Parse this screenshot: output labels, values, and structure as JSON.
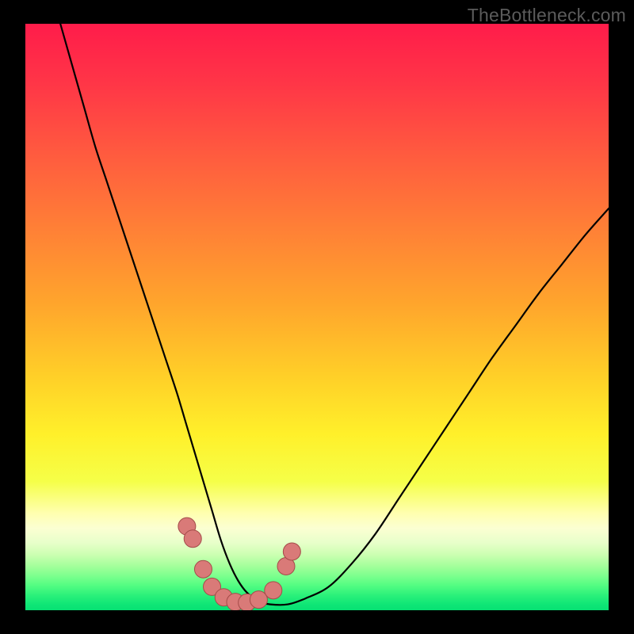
{
  "watermark": "TheBottleneck.com",
  "colors": {
    "frame": "#000000",
    "curve_stroke": "#000000",
    "marker_fill": "#d97a78",
    "marker_stroke": "#a44b49",
    "gradient_stops": [
      {
        "offset": 0.0,
        "color": "#ff1c4a"
      },
      {
        "offset": 0.1,
        "color": "#ff3547"
      },
      {
        "offset": 0.22,
        "color": "#ff5a3f"
      },
      {
        "offset": 0.35,
        "color": "#ff8036"
      },
      {
        "offset": 0.48,
        "color": "#ffa62c"
      },
      {
        "offset": 0.6,
        "color": "#ffcf28"
      },
      {
        "offset": 0.7,
        "color": "#fff02a"
      },
      {
        "offset": 0.78,
        "color": "#f5ff48"
      },
      {
        "offset": 0.835,
        "color": "#ffffb0"
      },
      {
        "offset": 0.86,
        "color": "#fbffd2"
      },
      {
        "offset": 0.885,
        "color": "#e8ffca"
      },
      {
        "offset": 0.905,
        "color": "#ccffb2"
      },
      {
        "offset": 0.925,
        "color": "#a3ff9b"
      },
      {
        "offset": 0.942,
        "color": "#7bff8d"
      },
      {
        "offset": 0.958,
        "color": "#52fd82"
      },
      {
        "offset": 0.975,
        "color": "#2af07a"
      },
      {
        "offset": 0.99,
        "color": "#0fe676"
      },
      {
        "offset": 1.0,
        "color": "#07e173"
      }
    ]
  },
  "chart_data": {
    "type": "line",
    "title": "",
    "xlabel": "",
    "ylabel": "",
    "xlim": [
      0,
      100
    ],
    "ylim": [
      0,
      100
    ],
    "series": [
      {
        "name": "bottleneck-curve",
        "x": [
          6,
          8,
          10,
          12,
          14,
          16,
          18,
          20,
          22,
          24,
          26,
          27.5,
          29,
          30.5,
          32,
          33.5,
          35,
          36.5,
          38,
          40,
          42,
          45,
          48,
          52,
          56,
          60,
          64,
          68,
          72,
          76,
          80,
          84,
          88,
          92,
          96,
          100
        ],
        "y": [
          100,
          93,
          86,
          79,
          73,
          67,
          61,
          55,
          49,
          43,
          37,
          32,
          27,
          22,
          17,
          12,
          8,
          5,
          3,
          1.5,
          1,
          1,
          2,
          4,
          8,
          13,
          19,
          25,
          31,
          37,
          43,
          48.5,
          54,
          59,
          64,
          68.5
        ]
      }
    ],
    "markers": {
      "name": "highlighted-points",
      "x": [
        27.7,
        28.7,
        30.5,
        32.0,
        34.0,
        36.0,
        38.0,
        40.0,
        42.5,
        44.7,
        45.7
      ],
      "y": [
        14.3,
        12.2,
        7.0,
        4.0,
        2.2,
        1.4,
        1.3,
        1.8,
        3.4,
        7.5,
        10.0
      ]
    }
  }
}
